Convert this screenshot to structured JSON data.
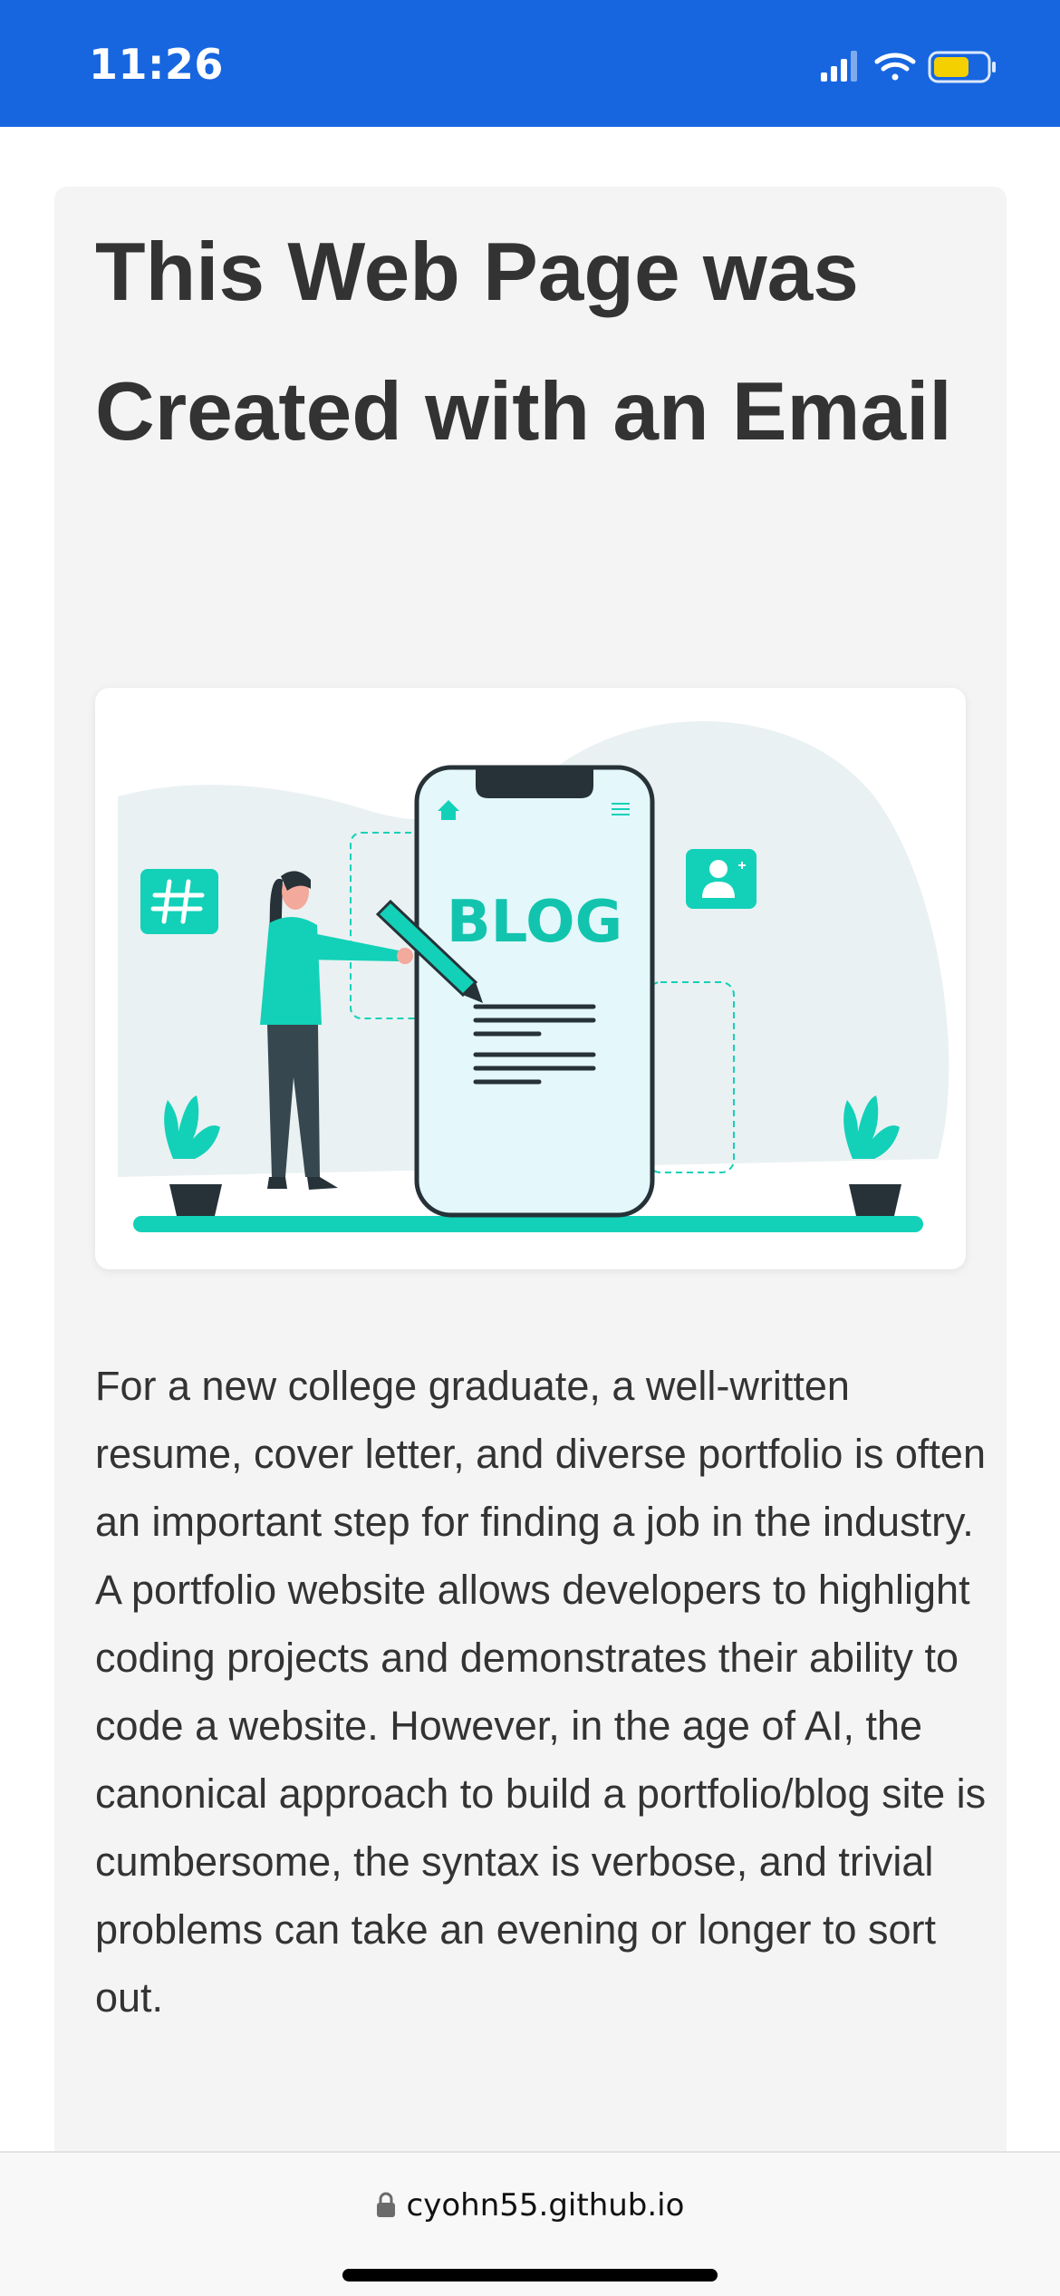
{
  "status_bar": {
    "time": "11:26",
    "icons": [
      "cellular-signal-icon",
      "wifi-icon",
      "battery-icon"
    ],
    "battery_color": "#f5d000",
    "background": "#1766e0"
  },
  "article": {
    "title": "This Web Page was Created with an Email",
    "hero_image": {
      "text": "BLOG",
      "icons": [
        "hashtag-icon",
        "user-profile-icon",
        "home-icon",
        "menu-icon",
        "pencil-icon",
        "plant-icon"
      ]
    },
    "paragraph": "For a new college graduate, a well-written resume, cover letter, and diverse portfolio is often an important step for finding a job in the industry. A portfolio website allows developers to highlight coding projects and demonstrates their ability to code a website. However, in the age of AI, the canonical approach to build a portfolio/blog site is cumbersome, the syntax is verbose, and trivial problems can take an evening or longer to sort out."
  },
  "browser": {
    "url": "cyohn55.github.io",
    "lock_icon": "lock-icon"
  },
  "colors": {
    "accent_teal": "#12d1b8",
    "text": "#333333",
    "card_bg": "#f4f4f4"
  }
}
